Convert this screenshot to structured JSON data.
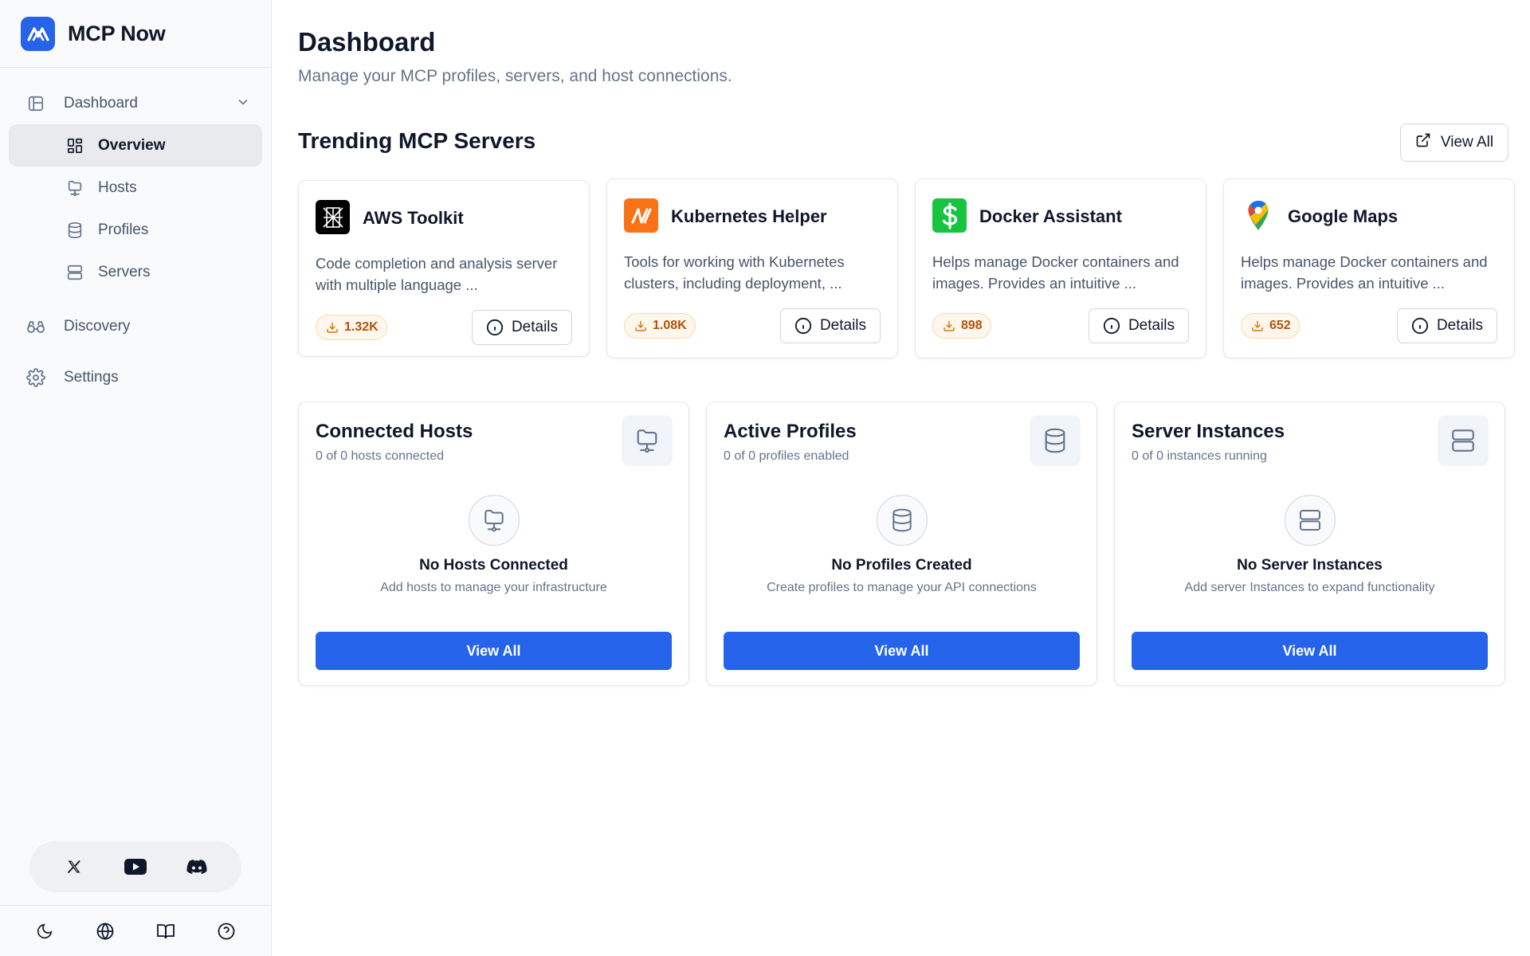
{
  "app": {
    "name": "MCP Now",
    "brand_color": "#2563eb"
  },
  "sidebar": {
    "dashboard_label": "Dashboard",
    "sub_items": [
      {
        "label": "Overview",
        "icon": "grid-icon",
        "active": true
      },
      {
        "label": "Hosts",
        "icon": "monitor-icon",
        "active": false
      },
      {
        "label": "Profiles",
        "icon": "database-icon",
        "active": false
      },
      {
        "label": "Servers",
        "icon": "server-icon",
        "active": false
      }
    ],
    "discovery_label": "Discovery",
    "settings_label": "Settings",
    "social": [
      "x-icon",
      "youtube-icon",
      "discord-icon"
    ],
    "footer": [
      "moon-icon",
      "globe-icon",
      "book-icon",
      "help-icon"
    ]
  },
  "header": {
    "title": "Dashboard",
    "subtitle": "Manage your MCP profiles, servers, and host connections."
  },
  "trending": {
    "title": "Trending MCP Servers",
    "view_all_label": "View All",
    "details_label": "Details",
    "cards": [
      {
        "name": "AWS Toolkit",
        "description": "Code completion and analysis server with multiple language ...",
        "downloads": "1.32K",
        "icon": "aws-toolkit-logo"
      },
      {
        "name": "Kubernetes Helper",
        "description": "Tools for working with Kubernetes clusters, including deployment, ...",
        "downloads": "1.08K",
        "icon": "kubernetes-helper-logo"
      },
      {
        "name": "Docker Assistant",
        "description": "Helps manage Docker containers and images. Provides an intuitive ...",
        "downloads": "898",
        "icon": "dollar-logo"
      },
      {
        "name": "Google Maps",
        "description": "Helps manage Docker containers and images. Provides an intuitive ...",
        "downloads": "652",
        "icon": "google-maps-logo"
      }
    ]
  },
  "stats": [
    {
      "title": "Connected Hosts",
      "subtitle": "0 of 0 hosts connected",
      "empty_title": "No Hosts Connected",
      "empty_subtitle": "Add hosts to manage your infrastructure",
      "cta": "View All",
      "icon": "monitor-icon"
    },
    {
      "title": "Active Profiles",
      "subtitle": "0 of 0 profiles enabled",
      "empty_title": "No Profiles Created",
      "empty_subtitle": "Create profiles to manage your API connections",
      "cta": "View All",
      "icon": "database-icon"
    },
    {
      "title": "Server Instances",
      "subtitle": "0 of 0 instances running",
      "empty_title": "No Server Instances",
      "empty_subtitle": "Add server Instances to expand functionality",
      "cta": "View All",
      "icon": "server-icon"
    }
  ]
}
